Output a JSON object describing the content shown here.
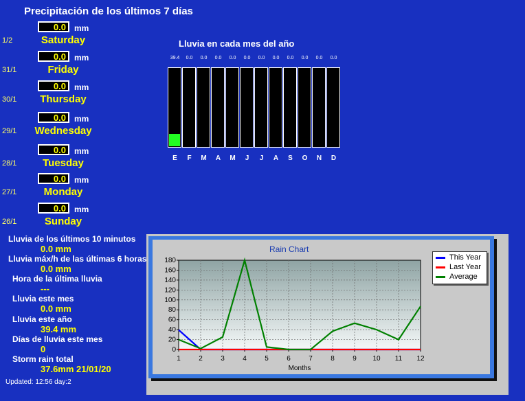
{
  "page": {
    "title": "Precipitación de los últimos 7 días",
    "updated": "Updated: 12:56 day:2"
  },
  "days": [
    {
      "date": "1/2",
      "value": "0.0",
      "unit": "mm",
      "name": "Saturday"
    },
    {
      "date": "31/1",
      "value": "0.0",
      "unit": "mm",
      "name": "Friday"
    },
    {
      "date": "30/1",
      "value": "0.0",
      "unit": "mm",
      "name": "Thursday"
    },
    {
      "date": "29/1",
      "value": "0.0",
      "unit": "mm",
      "name": "Wednesday"
    },
    {
      "date": "28/1",
      "value": "0.0",
      "unit": "mm",
      "name": "Tuesday"
    },
    {
      "date": "27/1",
      "value": "0.0",
      "unit": "mm",
      "name": "Monday"
    },
    {
      "date": "26/1",
      "value": "0.0",
      "unit": "mm",
      "name": "Sunday"
    }
  ],
  "stats": [
    {
      "label": "Lluvia de los últimos 10 minutos",
      "value": "0.0 mm"
    },
    {
      "label": "Lluvia máx/h de las últimas 6 horas",
      "value": "0.0 mm"
    },
    {
      "label": "Hora de la última lluvia",
      "value": "---"
    },
    {
      "label": "Lluvia este mes",
      "value": "0.0 mm"
    },
    {
      "label": "Lluvia este año",
      "value": "39.4 mm"
    },
    {
      "label": "Días de lluvia este mes",
      "value": "0"
    },
    {
      "label": "Storm rain total",
      "value": "37.6mm 21/01/20"
    }
  ],
  "monthly": {
    "title": "Lluvia en cada mes del año",
    "letters": [
      "E",
      "F",
      "M",
      "A",
      "M",
      "J",
      "J",
      "A",
      "S",
      "O",
      "N",
      "D"
    ],
    "value_labels": [
      "39.4",
      "0.0",
      "0.0",
      "0.0",
      "0.0",
      "0.0",
      "0.0",
      "0.0",
      "0.0",
      "0.0",
      "0.0",
      "0.0"
    ],
    "values": [
      39.4,
      0,
      0,
      0,
      0,
      0,
      0,
      0,
      0,
      0,
      0,
      0
    ],
    "fill_fraction": [
      0.16,
      0,
      0,
      0,
      0,
      0,
      0,
      0,
      0,
      0,
      0,
      0
    ],
    "fill_color": "#22ff22"
  },
  "chart_data": {
    "type": "line",
    "title": "Rain Chart",
    "xlabel": "Months",
    "ylabel": "",
    "x": [
      1,
      2,
      3,
      4,
      5,
      6,
      7,
      8,
      9,
      10,
      11,
      12
    ],
    "xlim": [
      1,
      12
    ],
    "ylim": [
      0,
      180
    ],
    "yticks": [
      0,
      20,
      40,
      60,
      80,
      100,
      120,
      140,
      160,
      180
    ],
    "grid": true,
    "legend_position": "top-right",
    "series": [
      {
        "name": "This Year",
        "color": "#0000ff",
        "values": [
          39.4,
          0,
          0,
          0,
          0,
          0,
          0,
          0,
          0,
          0,
          0,
          0
        ]
      },
      {
        "name": "Last Year",
        "color": "#ff0000",
        "values": [
          0,
          0,
          0,
          0,
          0,
          0,
          0,
          0,
          0,
          0,
          0,
          0
        ]
      },
      {
        "name": "Average",
        "color": "#008000",
        "values": [
          20,
          2,
          25,
          180,
          5,
          0,
          0,
          37,
          53,
          40,
          20,
          87
        ]
      }
    ]
  }
}
